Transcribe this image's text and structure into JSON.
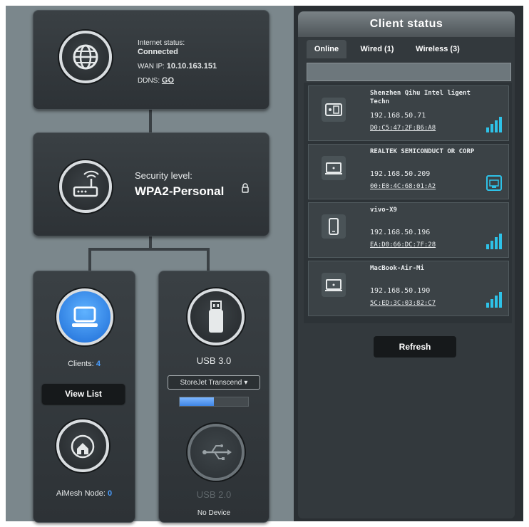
{
  "internet": {
    "status_label": "Internet status:",
    "status_value": "Connected",
    "wan_label": "WAN IP:",
    "wan_value": "10.10.163.151",
    "ddns_label": "DDNS:",
    "ddns_value": "GO"
  },
  "security": {
    "label": "Security level:",
    "value": "WPA2-Personal"
  },
  "clients_card": {
    "label": "Clients:",
    "count": "4",
    "view_list": "View List"
  },
  "aimesh": {
    "label": "AiMesh Node:",
    "count": "0"
  },
  "usb3": {
    "label": "USB 3.0",
    "device": "StoreJet Transcend",
    "usage_fraction": 0.5
  },
  "usb2": {
    "label": "USB 2.0",
    "status": "No Device"
  },
  "client_status": {
    "title": "Client status",
    "tabs": [
      "Online",
      "Wired (1)",
      "Wireless (3)"
    ],
    "clients": [
      {
        "name": "Shenzhen Qihu Intel ligent Techn",
        "ip": "192.168.50.71",
        "mac": "D0:C5:47:2F:B6:A8",
        "icon": "tablet-icon",
        "signal": "wifi-signal-icon"
      },
      {
        "name": "REALTEK SEMICONDUCT OR CORP",
        "ip": "192.168.50.209",
        "mac": "00:E0:4C:68:01:A2",
        "icon": "laptop-icon",
        "signal": "wired-icon"
      },
      {
        "name": "vivo-X9",
        "ip": "192.168.50.196",
        "mac": "EA:D0:66:DC:7F:28",
        "icon": "phone-icon",
        "signal": "wifi-signal-icon"
      },
      {
        "name": "MacBook-Air-Mi",
        "ip": "192.168.50.190",
        "mac": "5C:ED:3C:03:82:C7",
        "icon": "laptop-icon",
        "signal": "wifi-signal-icon"
      }
    ],
    "refresh": "Refresh"
  },
  "colors": {
    "accent": "#4a9eff",
    "signal": "#2ec2e8"
  }
}
